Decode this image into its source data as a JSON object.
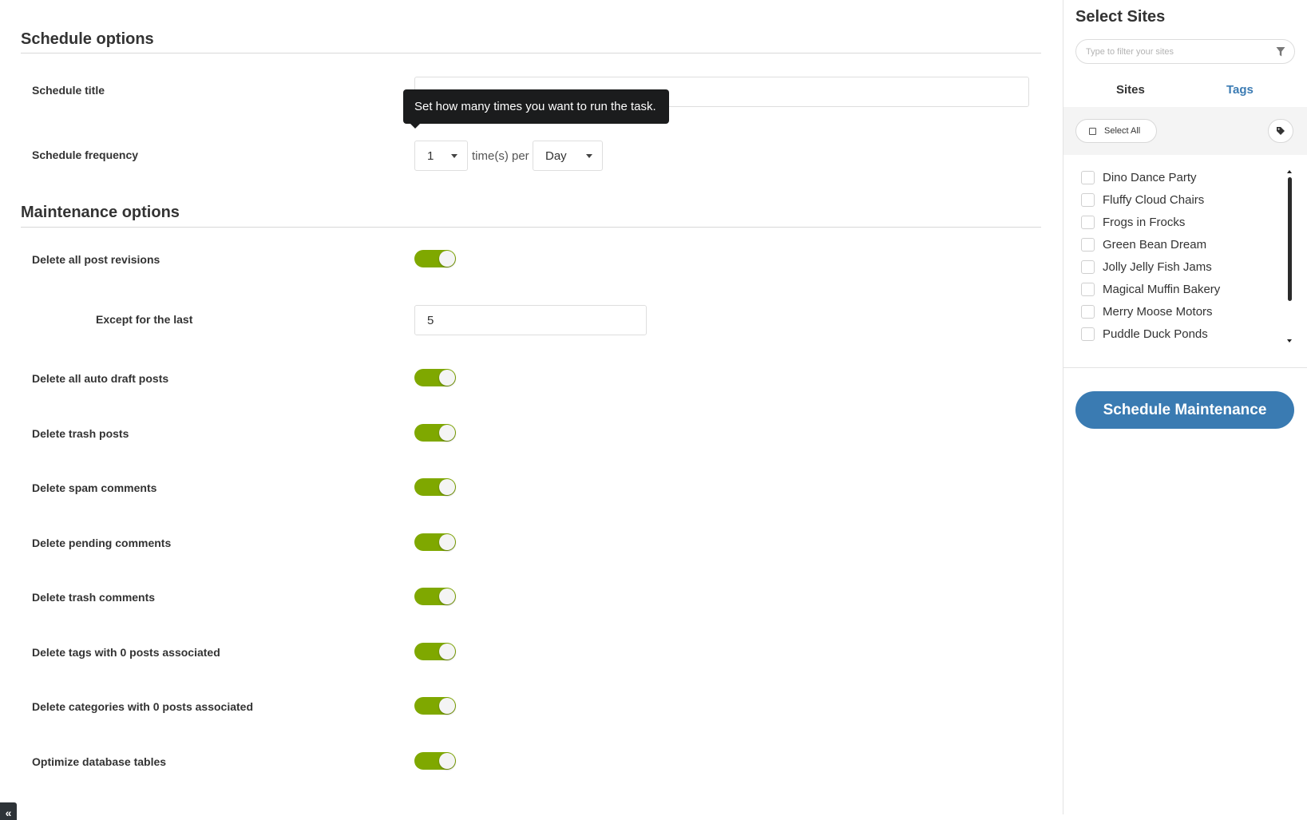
{
  "schedule_options": {
    "heading": "Schedule options",
    "title_label": "Schedule title",
    "title_value": "",
    "frequency_label": "Schedule frequency",
    "frequency_count": "1",
    "frequency_per_text": "time(s) per",
    "frequency_period": "Day",
    "tooltip": "Set how many times you want to run the task."
  },
  "maintenance_options": {
    "heading": "Maintenance options",
    "items": [
      {
        "label": "Delete all post revisions",
        "enabled": true
      },
      {
        "label": "Delete all auto draft posts",
        "enabled": true
      },
      {
        "label": "Delete trash posts",
        "enabled": true
      },
      {
        "label": "Delete spam comments",
        "enabled": true
      },
      {
        "label": "Delete pending comments",
        "enabled": true
      },
      {
        "label": "Delete trash comments",
        "enabled": true
      },
      {
        "label": "Delete tags with 0 posts associated",
        "enabled": true
      },
      {
        "label": "Delete categories with 0 posts associated",
        "enabled": true
      },
      {
        "label": "Optimize database tables",
        "enabled": true
      }
    ],
    "except_label": "Except for the last",
    "except_value": "5"
  },
  "sidebar": {
    "title": "Select Sites",
    "filter_placeholder": "Type to filter your sites",
    "tabs": [
      {
        "label": "Sites",
        "active": true
      },
      {
        "label": "Tags",
        "active": false
      }
    ],
    "select_all_label": "Select All",
    "sites": [
      "Dino Dance Party",
      "Fluffy Cloud Chairs",
      "Frogs in Frocks",
      "Green Bean Dream",
      "Jolly Jelly Fish Jams",
      "Magical Muffin Bakery",
      "Merry Moose Motors",
      "Puddle Duck Ponds"
    ],
    "primary_button": "Schedule Maintenance"
  },
  "colors": {
    "toggle_on": "#7fa800",
    "primary": "#3a7bb2",
    "tab_active_link": "#3b7bb3",
    "tooltip_bg": "#1b1c1d"
  },
  "icons": {
    "filter": "filter-icon",
    "tag": "tag-icon",
    "collapse": "double-chevron-left-icon",
    "dropdown": "caret-down-icon"
  }
}
